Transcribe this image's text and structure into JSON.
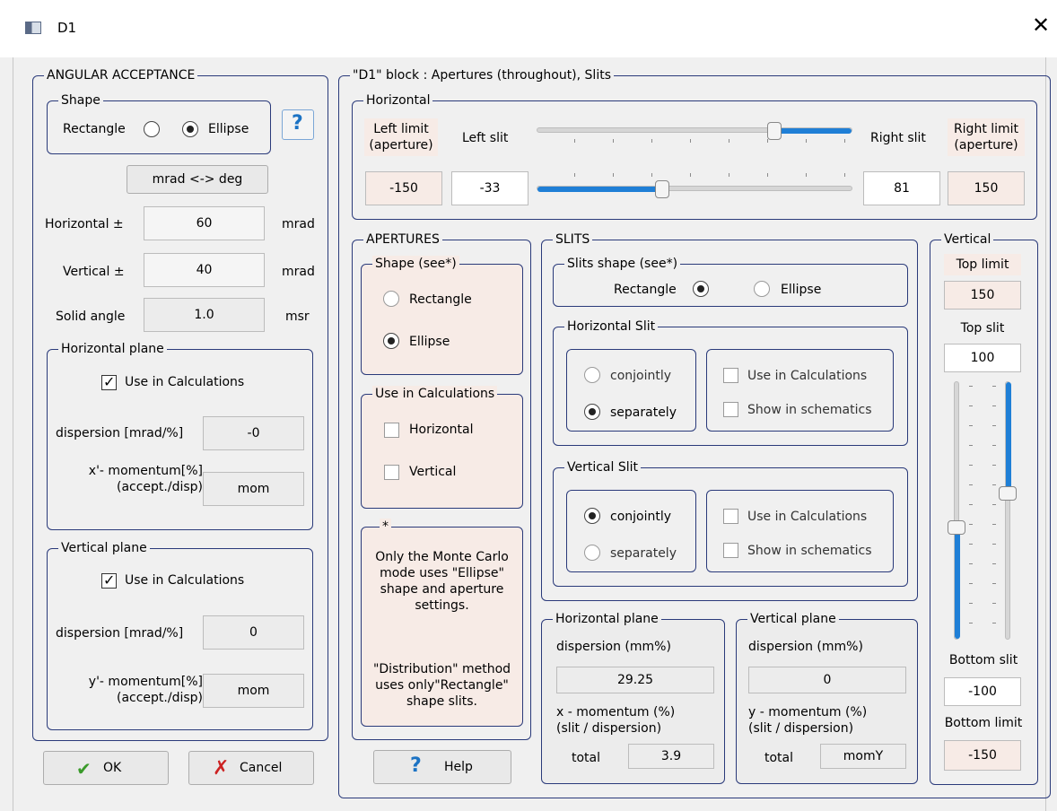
{
  "window": {
    "title": "D1",
    "close_glyph": "✕"
  },
  "angular": {
    "legend": "ANGULAR ACCEPTANCE",
    "shape_legend": "Shape",
    "rectangle": "Rectangle",
    "ellipse": "Ellipse",
    "help_glyph": "?",
    "convert_button": "mrad <-> deg",
    "horizontal_label": "Horizontal ±",
    "horizontal_value": "60",
    "horizontal_unit": "mrad",
    "vertical_label": "Vertical ±",
    "vertical_value": "40",
    "vertical_unit": "mrad",
    "solid_label": "Solid angle",
    "solid_value": "1.0",
    "solid_unit": "msr"
  },
  "hplane": {
    "legend": "Horizontal plane",
    "use_calc": "Use in Calculations",
    "dispersion_label": "dispersion [mrad/%]",
    "dispersion_value": "-0",
    "momentum_label_1": "x'- momentum[%]",
    "momentum_label_2": "(accept./disp)",
    "momentum_value": "mom"
  },
  "vplane": {
    "legend": "Vertical plane",
    "use_calc": "Use in Calculations",
    "dispersion_label": "dispersion [mrad/%]",
    "dispersion_value": "0",
    "momentum_label_1": "y'- momentum[%]",
    "momentum_label_2": "(accept./disp)",
    "momentum_value": "mom"
  },
  "buttons": {
    "ok": "OK",
    "cancel": "Cancel",
    "help": "Help"
  },
  "block": {
    "legend": "\"D1\" block : Apertures (throughout), Slits",
    "horizontal_legend": "Horizontal",
    "left_limit_1": "Left limit",
    "left_limit_2": "(aperture)",
    "left_slit": "Left slit",
    "right_slit": "Right slit",
    "right_limit_1": "Right limit",
    "right_limit_2": "(aperture)",
    "left_limit_value": "-150",
    "left_slit_value": "-33",
    "right_slit_value": "81",
    "right_limit_value": "150"
  },
  "apertures": {
    "legend": "APERTURES",
    "shape_legend": "Shape (see*)",
    "rectangle": "Rectangle",
    "ellipse": "Ellipse",
    "use_legend": "Use in Calculations",
    "horizontal": "Horizontal",
    "vertical": "Vertical",
    "note_legend": "*",
    "note_1": "Only the Monte Carlo",
    "note_2": "mode uses \"Ellipse\"",
    "note_3": "shape and aperture",
    "note_4": "settings.",
    "note_5": "\"Distribution\" method",
    "note_6": "uses only\"Rectangle\"",
    "note_7": "shape slits."
  },
  "slits": {
    "legend": "SLITS",
    "shape_legend": "Slits shape (see*)",
    "rectangle": "Rectangle",
    "ellipse": "Ellipse",
    "hslit_legend": "Horizontal Slit",
    "vslit_legend": "Vertical Slit",
    "conjointly": "conjointly",
    "separately": "separately",
    "use_calc": "Use in Calculations",
    "show_schem": "Show in schematics"
  },
  "hplane2": {
    "legend": "Horizontal plane",
    "dispersion_label": "dispersion (mm%)",
    "dispersion_value": "29.25",
    "momentum_1": "x - momentum (%)",
    "momentum_2": "(slit / dispersion)",
    "total_label": "total",
    "total_value": "3.9"
  },
  "vplane2": {
    "legend": "Vertical plane",
    "dispersion_label": "dispersion (mm%)",
    "dispersion_value": "0",
    "momentum_1": "y - momentum (%)",
    "momentum_2": "(slit / dispersion)",
    "total_label": "total",
    "total_value": "momY"
  },
  "vertical": {
    "legend": "Vertical",
    "top_limit": "Top limit",
    "top_limit_value": "150",
    "top_slit": "Top slit",
    "top_slit_value": "100",
    "bottom_slit": "Bottom slit",
    "bottom_slit_value": "-100",
    "bottom_limit": "Bottom limit",
    "bottom_limit_value": "-150"
  },
  "colors": {
    "frame": "#2a3a7a",
    "accent": "#1f7fd6",
    "tint": "#f7ebe6",
    "ok_check": "#3a9a2a",
    "cancel_x": "#cc2222"
  }
}
